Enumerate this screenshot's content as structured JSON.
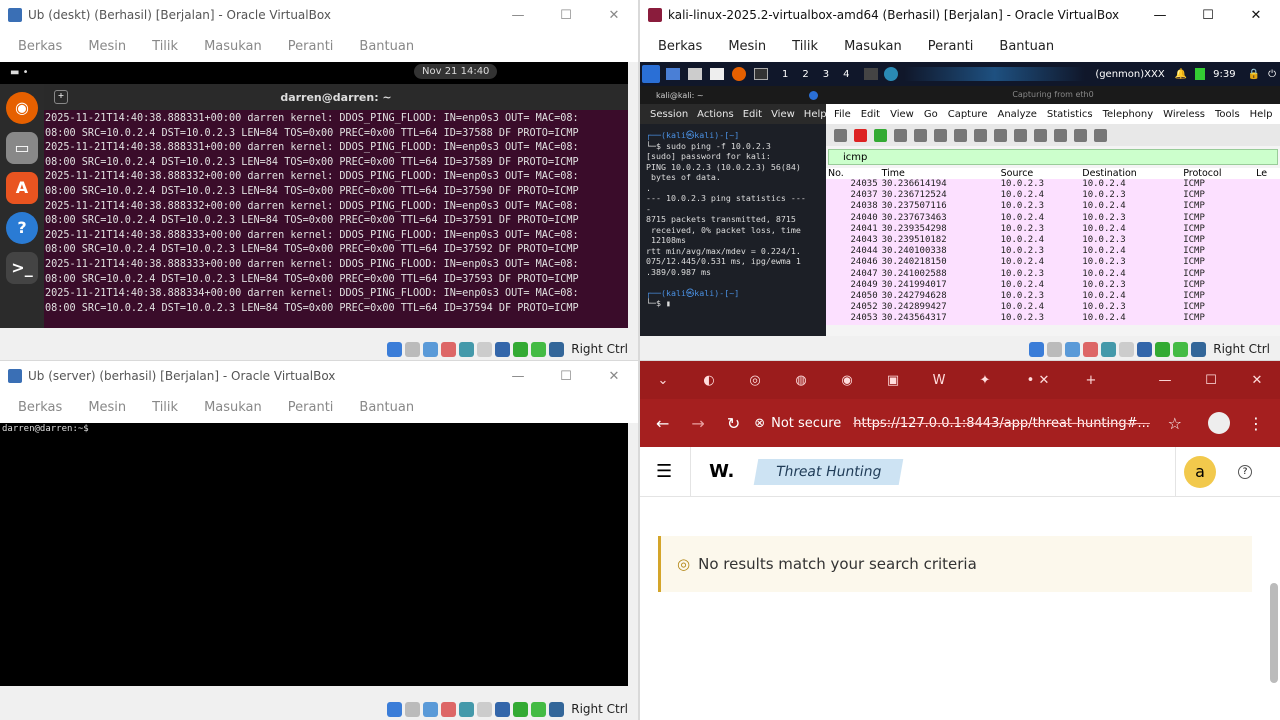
{
  "win1": {
    "title": "Ub (deskt) (Berhasil) [Berjalan] - Oracle VirtualBox",
    "menu": [
      "Berkas",
      "Mesin",
      "Tilik",
      "Masukan",
      "Peranti",
      "Bantuan"
    ],
    "clock": "Nov 21  14:40",
    "terminal_title": "darren@darren: ~",
    "log_lines": [
      "2025-11-21T14:40:38.888331+00:00 darren kernel: DDOS_PING_FLOOD: IN=enp0s3 OUT= MAC=08:",
      "08:00 SRC=10.0.2.4 DST=10.0.2.3 LEN=84 TOS=0x00 PREC=0x00 TTL=64 ID=37588 DF PROTO=ICMP",
      "2025-11-21T14:40:38.888331+00:00 darren kernel: DDOS_PING_FLOOD: IN=enp0s3 OUT= MAC=08:",
      "08:00 SRC=10.0.2.4 DST=10.0.2.3 LEN=84 TOS=0x00 PREC=0x00 TTL=64 ID=37589 DF PROTO=ICMP",
      "2025-11-21T14:40:38.888332+00:00 darren kernel: DDOS_PING_FLOOD: IN=enp0s3 OUT= MAC=08:",
      "08:00 SRC=10.0.2.4 DST=10.0.2.3 LEN=84 TOS=0x00 PREC=0x00 TTL=64 ID=37590 DF PROTO=ICMP",
      "2025-11-21T14:40:38.888332+00:00 darren kernel: DDOS_PING_FLOOD: IN=enp0s3 OUT= MAC=08:",
      "08:00 SRC=10.0.2.4 DST=10.0.2.3 LEN=84 TOS=0x00 PREC=0x00 TTL=64 ID=37591 DF PROTO=ICMP",
      "2025-11-21T14:40:38.888333+00:00 darren kernel: DDOS_PING_FLOOD: IN=enp0s3 OUT= MAC=08:",
      "08:00 SRC=10.0.2.4 DST=10.0.2.3 LEN=84 TOS=0x00 PREC=0x00 TTL=64 ID=37592 DF PROTO=ICMP",
      "2025-11-21T14:40:38.888333+00:00 darren kernel: DDOS_PING_FLOOD: IN=enp0s3 OUT= MAC=08:",
      "08:00 SRC=10.0.2.4 DST=10.0.2.3 LEN=84 TOS=0x00 PREC=0x00 TTL=64 ID=37593 DF PROTO=ICMP",
      "2025-11-21T14:40:38.888334+00:00 darren kernel: DDOS_PING_FLOOD: IN=enp0s3 OUT= MAC=08:",
      "08:00 SRC=10.0.2.4 DST=10.0.2.3 LEN=84 TOS=0x00 PREC=0x00 TTL=64 ID=37594 DF PROTO=ICMP"
    ],
    "host_key": "Right Ctrl"
  },
  "win2": {
    "title": "Ub (server) (berhasil) [Berjalan] - Oracle VirtualBox",
    "menu": [
      "Berkas",
      "Mesin",
      "Tilik",
      "Masukan",
      "Peranti",
      "Bantuan"
    ],
    "prompt": "darren@darren:~$",
    "host_key": "Right Ctrl"
  },
  "win3": {
    "title": "kali-linux-2025.2-virtualbox-amd64 (Berhasil) [Berjalan] - Oracle VirtualBox",
    "menu": [
      "Berkas",
      "Mesin",
      "Tilik",
      "Masukan",
      "Peranti",
      "Bantuan"
    ],
    "taskbar": {
      "workspaces": [
        "1",
        "2",
        "3",
        "4"
      ],
      "user": "(genmon)XXX",
      "time": "9:39"
    },
    "terminal": {
      "title": "kali@kali: ~",
      "menu": [
        "Session",
        "Actions",
        "Edit",
        "View",
        "Help"
      ],
      "lines": [
        "┌──(kali㉿kali)-[~]",
        "└─$ sudo ping -f 10.0.2.3",
        "[sudo] password for kali:",
        "PING 10.0.2.3 (10.0.2.3) 56(84)",
        " bytes of data.",
        ".",
        "--- 10.0.2.3 ping statistics ---",
        "-",
        "8715 packets transmitted, 8715",
        " received, 0% packet loss, time",
        " 12108ms",
        "rtt min/avg/max/mdev = 0.224/1.",
        "075/12.445/0.531 ms, ipg/ewma 1",
        ".389/0.987 ms",
        "",
        "┌──(kali㉿kali)-[~]",
        "└─$ ▮"
      ]
    },
    "wireshark": {
      "title": "Capturing from eth0",
      "menu": [
        "File",
        "Edit",
        "View",
        "Go",
        "Capture",
        "Analyze",
        "Statistics",
        "Telephony",
        "Wireless",
        "Tools",
        "Help"
      ],
      "filter": "icmp",
      "columns": [
        "No.",
        "Time",
        "Source",
        "Destination",
        "Protocol",
        "Le"
      ],
      "rows": [
        [
          "24035",
          "30.236614194",
          "10.0.2.3",
          "10.0.2.4",
          "ICMP"
        ],
        [
          "24037",
          "30.236712524",
          "10.0.2.4",
          "10.0.2.3",
          "ICMP"
        ],
        [
          "24038",
          "30.237507116",
          "10.0.2.3",
          "10.0.2.4",
          "ICMP"
        ],
        [
          "24040",
          "30.237673463",
          "10.0.2.4",
          "10.0.2.3",
          "ICMP"
        ],
        [
          "24041",
          "30.239354298",
          "10.0.2.3",
          "10.0.2.4",
          "ICMP"
        ],
        [
          "24043",
          "30.239510182",
          "10.0.2.4",
          "10.0.2.3",
          "ICMP"
        ],
        [
          "24044",
          "30.240100338",
          "10.0.2.3",
          "10.0.2.4",
          "ICMP"
        ],
        [
          "24046",
          "30.240218150",
          "10.0.2.4",
          "10.0.2.3",
          "ICMP"
        ],
        [
          "24047",
          "30.241002588",
          "10.0.2.3",
          "10.0.2.4",
          "ICMP"
        ],
        [
          "24049",
          "30.241994017",
          "10.0.2.4",
          "10.0.2.3",
          "ICMP"
        ],
        [
          "24050",
          "30.242794628",
          "10.0.2.3",
          "10.0.2.4",
          "ICMP"
        ],
        [
          "24052",
          "30.242899427",
          "10.0.2.4",
          "10.0.2.3",
          "ICMP"
        ],
        [
          "24053",
          "30.243564317",
          "10.0.2.3",
          "10.0.2.4",
          "ICMP"
        ]
      ]
    },
    "host_key": "Right Ctrl"
  },
  "browser": {
    "not_secure": "Not secure",
    "url": "https://127.0.0.1:8443/app/threat-hunting#...",
    "logo": "W.",
    "section": "Threat Hunting",
    "avatar": "a",
    "help": "?",
    "empty_message": "No results match your search criteria"
  },
  "colors": {
    "browser_bar": "#a51f1f",
    "accent_yellow": "#f2c94c",
    "chip": "#cde3f3"
  }
}
